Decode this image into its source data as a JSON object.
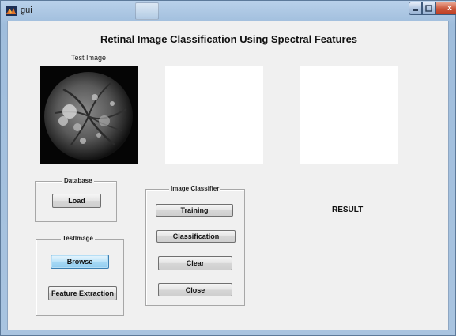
{
  "window": {
    "title": "gui",
    "icon": "matlab-figure-icon",
    "caption_buttons": {
      "minimize": "minimize-icon",
      "maximize": "maximize-icon",
      "close": "x"
    }
  },
  "header": {
    "title": "Retinal Image Classification Using Spectral Features"
  },
  "test_image": {
    "caption": "Test Image",
    "description_icon": "retina-fundus-image"
  },
  "database_panel": {
    "title": "Database",
    "load_label": "Load"
  },
  "testimage_panel": {
    "title": "TestImage",
    "browse_label": "Browse",
    "feature_extraction_label": "Feature Extraction"
  },
  "classifier_panel": {
    "title": "Image Classifier",
    "training_label": "Training",
    "classification_label": "Classification",
    "clear_label": "Clear",
    "close_label": "Close"
  },
  "result": {
    "label": "RESULT"
  },
  "colors": {
    "frame": "#a9c4e0",
    "client_bg": "#f0f0f0",
    "close_button": "#c9553a",
    "focused_button": "#bde4f9"
  }
}
